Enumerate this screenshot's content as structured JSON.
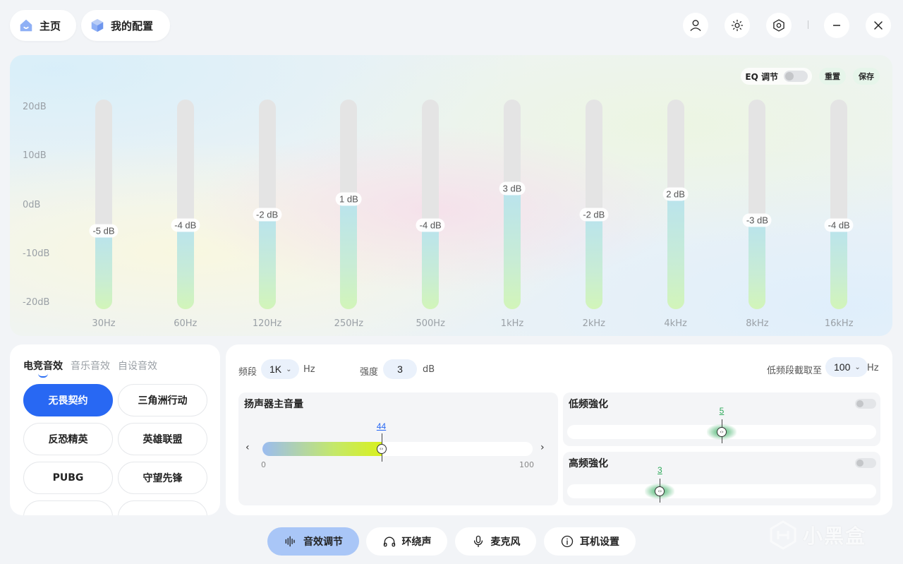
{
  "topbar": {
    "home_label": "主页",
    "config_label": "我的配置",
    "icons": [
      "home-icon",
      "cube-icon",
      "user-icon",
      "brightness-icon",
      "settings-icon",
      "minimize-icon",
      "close-icon"
    ]
  },
  "eq": {
    "toggle_label": "EQ 调节",
    "toggle_on": false,
    "reset_label": "重置",
    "save_label": "保存",
    "y_labels": [
      "20dB",
      "10dB",
      "0dB",
      "-10dB",
      "-20dB"
    ],
    "range_db": [
      -20,
      20
    ],
    "bands": [
      {
        "freq": "30Hz",
        "value": -5,
        "label": "-5 dB"
      },
      {
        "freq": "60Hz",
        "value": -4,
        "label": "-4 dB"
      },
      {
        "freq": "120Hz",
        "value": -2,
        "label": "-2 dB"
      },
      {
        "freq": "250Hz",
        "value": 1,
        "label": "1 dB"
      },
      {
        "freq": "500Hz",
        "value": -4,
        "label": "-4 dB"
      },
      {
        "freq": "1kHz",
        "value": 3,
        "label": "3 dB"
      },
      {
        "freq": "2kHz",
        "value": -2,
        "label": "-2 dB"
      },
      {
        "freq": "4kHz",
        "value": 2,
        "label": "2 dB"
      },
      {
        "freq": "8kHz",
        "value": -3,
        "label": "-3 dB"
      },
      {
        "freq": "16kHz",
        "value": -4,
        "label": "-4 dB"
      }
    ]
  },
  "presets": {
    "tabs": [
      "电竞音效",
      "音乐音效",
      "自设音效"
    ],
    "active_tab": 0,
    "items": [
      "无畏契约",
      "三角洲行动",
      "反恐精英",
      "英雄联盟",
      "PUBG",
      "守望先锋"
    ],
    "active_item": 0
  },
  "settings": {
    "band_label": "频段",
    "band_value": "1K",
    "band_unit": "Hz",
    "gain_label": "强度",
    "gain_value": "3",
    "gain_unit": "dB",
    "cutoff_label": "低频段截取至",
    "cutoff_value": "100",
    "cutoff_unit": "Hz",
    "volume": {
      "title": "扬声器主音量",
      "value": "44",
      "fraction": 0.44,
      "min": "0",
      "max": "100"
    },
    "bass": {
      "title": "低频強化",
      "value": "5",
      "fraction": 0.5,
      "enabled": false
    },
    "treble": {
      "title": "高频強化",
      "value": "3",
      "fraction": 0.3,
      "enabled": false
    },
    "accent_color": "#2868f3",
    "boost_color": "#2eaa5a"
  },
  "nav": [
    {
      "label": "音效调节",
      "icon": "sound-wave-icon",
      "active": true
    },
    {
      "label": "环绕声",
      "icon": "headphones-icon",
      "active": false
    },
    {
      "label": "麦克风",
      "icon": "microphone-icon",
      "active": false
    },
    {
      "label": "耳机设置",
      "icon": "info-icon",
      "active": false
    }
  ],
  "watermark": "小黑盒"
}
